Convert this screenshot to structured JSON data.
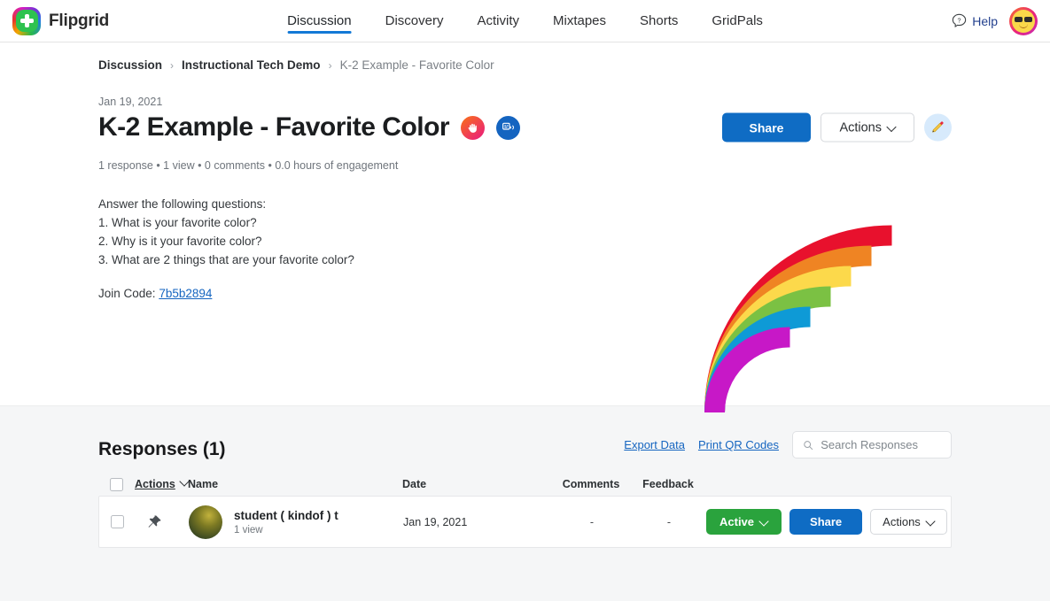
{
  "topnav": {
    "brand": "Flipgrid",
    "logo_icon": "flipgrid-logo-icon",
    "nav_items": [
      {
        "label": "Discussion",
        "active": true
      },
      {
        "label": "Discovery",
        "active": false
      },
      {
        "label": "Activity",
        "active": false
      },
      {
        "label": "Mixtapes",
        "active": false
      },
      {
        "label": "Shorts",
        "active": false
      },
      {
        "label": "GridPals",
        "active": false
      }
    ],
    "help_label": "Help",
    "help_icon": "question-bubble-icon",
    "avatar_icon": "sunglasses-emoji-avatar"
  },
  "breadcrumb": {
    "level1": "Discussion",
    "sep": "›",
    "level2": "Instructional Tech Demo",
    "current": "K-2 Example - Favorite Color"
  },
  "topic": {
    "date": "Jan 19, 2021",
    "title": "K-2 Example - Favorite Color",
    "badge_hand_icon": "raised-hand-icon",
    "badge_cc_icon": "audio-captions-icon",
    "stats": "1 response • 1 view • 0 comments • 0.0 hours of engagement",
    "share_label": "Share",
    "actions_label": "Actions",
    "edit_icon": "pencil-icon",
    "prompt_intro": "Answer the following questions:",
    "questions": [
      "1. What is your favorite color?",
      "2. Why is it your favorite color?",
      "3. What are 2 things that are your favorite color?"
    ],
    "join_label": "Join Code:",
    "join_code": "7b5b2894",
    "rainbow_icon": "rainbow-image",
    "rainbow_colors": [
      "#e8112d",
      "#ef8423",
      "#fcd94b",
      "#7bc143",
      "#0e9ad6",
      "#c718c7"
    ]
  },
  "responses": {
    "title": "Responses (1)",
    "export_label": "Export Data",
    "qr_label": "Print QR Codes",
    "search_placeholder": "Search Responses",
    "search_value": "",
    "search_icon": "search-icon",
    "columns": {
      "actions": "Actions",
      "name": "Name",
      "date": "Date",
      "comments": "Comments",
      "feedback": "Feedback"
    },
    "rows": [
      {
        "pin_icon": "pushpin-icon",
        "avatar_icon": "student-thumbnail",
        "name": "student ( kindof ) t",
        "views": "1 view",
        "date": "Jan 19, 2021",
        "comments": "-",
        "feedback": "-",
        "status_label": "Active",
        "share_label": "Share",
        "actions_label": "Actions"
      }
    ]
  },
  "colors": {
    "accent_blue": "#0f6cc4",
    "link_blue": "#1565c0",
    "green": "#2aa33d",
    "grey_bg": "#f5f6f7"
  }
}
